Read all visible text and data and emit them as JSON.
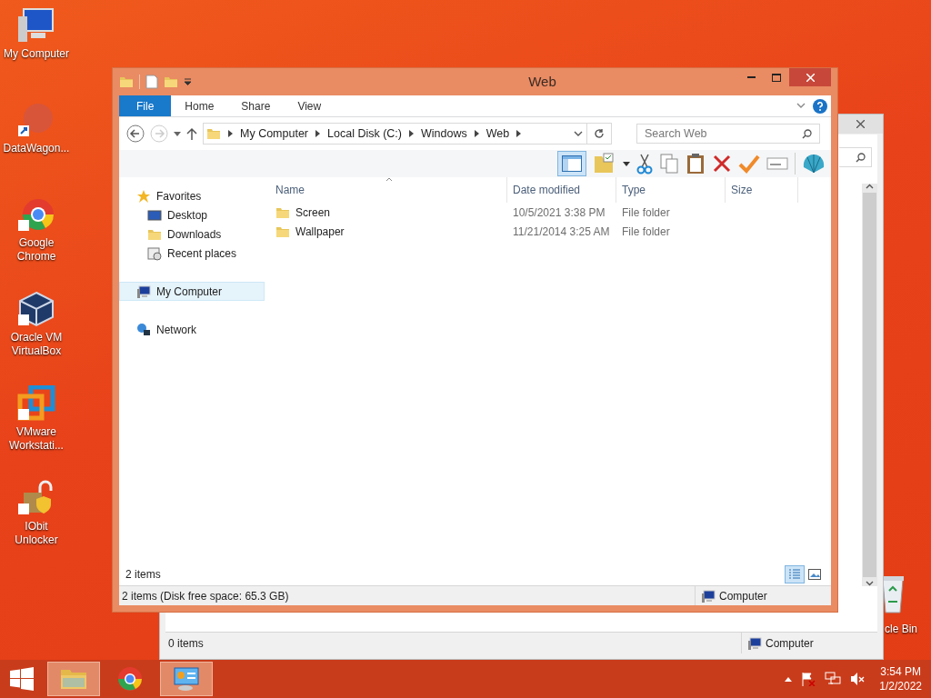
{
  "desktop_icons": [
    {
      "label": "My Computer",
      "kind": "computer"
    },
    {
      "label": "DataWagon...",
      "kind": "blur"
    },
    {
      "label": "Google Chrome",
      "kind": "chrome"
    },
    {
      "label": "Oracle VM VirtualBox",
      "kind": "box"
    },
    {
      "label": "VMware Workstati...",
      "kind": "vmware"
    },
    {
      "label": "IObit Unlocker",
      "kind": "lock"
    }
  ],
  "recycle_bin": {
    "label": "cle Bin"
  },
  "back_window": {
    "status_bar": {
      "items": "0 items",
      "location": "Computer"
    }
  },
  "window": {
    "title": "Web",
    "ribbon_tabs": [
      {
        "label": "File",
        "selected": true
      },
      {
        "label": "Home",
        "selected": false
      },
      {
        "label": "Share",
        "selected": false
      },
      {
        "label": "View",
        "selected": false
      }
    ],
    "breadcrumbs": [
      "My Computer",
      "Local Disk (C:)",
      "Windows",
      "Web"
    ],
    "search": {
      "placeholder": "Search Web"
    },
    "nav": [
      {
        "label": "Favorites",
        "kind": "star",
        "selected": false,
        "children": [
          {
            "label": "Desktop",
            "kind": "desktop",
            "selected": false
          },
          {
            "label": "Downloads",
            "kind": "downloads",
            "selected": false
          },
          {
            "label": "Recent places",
            "kind": "recent",
            "selected": false
          }
        ]
      },
      {
        "label": "My Computer",
        "kind": "computer",
        "selected": true
      },
      {
        "label": "Network",
        "kind": "network",
        "selected": false
      }
    ],
    "columns": [
      "Name",
      "Date modified",
      "Type",
      "Size"
    ],
    "rows": [
      {
        "name": "Screen",
        "date": "10/5/2021 3:38 PM",
        "type": "File folder"
      },
      {
        "name": "Wallpaper",
        "date": "11/21/2014 3:25 AM",
        "type": "File folder"
      }
    ],
    "views": [
      {
        "kind": "details",
        "selected": true
      },
      {
        "kind": "large",
        "selected": false
      }
    ],
    "item_count": "2 items",
    "status_bar": {
      "items": "2 items (Disk free space: 65.3 GB)",
      "location": "Computer"
    }
  },
  "taskbar": {
    "buttons": [
      {
        "kind": "explorer",
        "selected": true
      },
      {
        "kind": "chrome",
        "selected": false
      },
      {
        "kind": "control",
        "selected": true
      }
    ],
    "time": "3:54 PM",
    "date": "1/2/2022"
  }
}
